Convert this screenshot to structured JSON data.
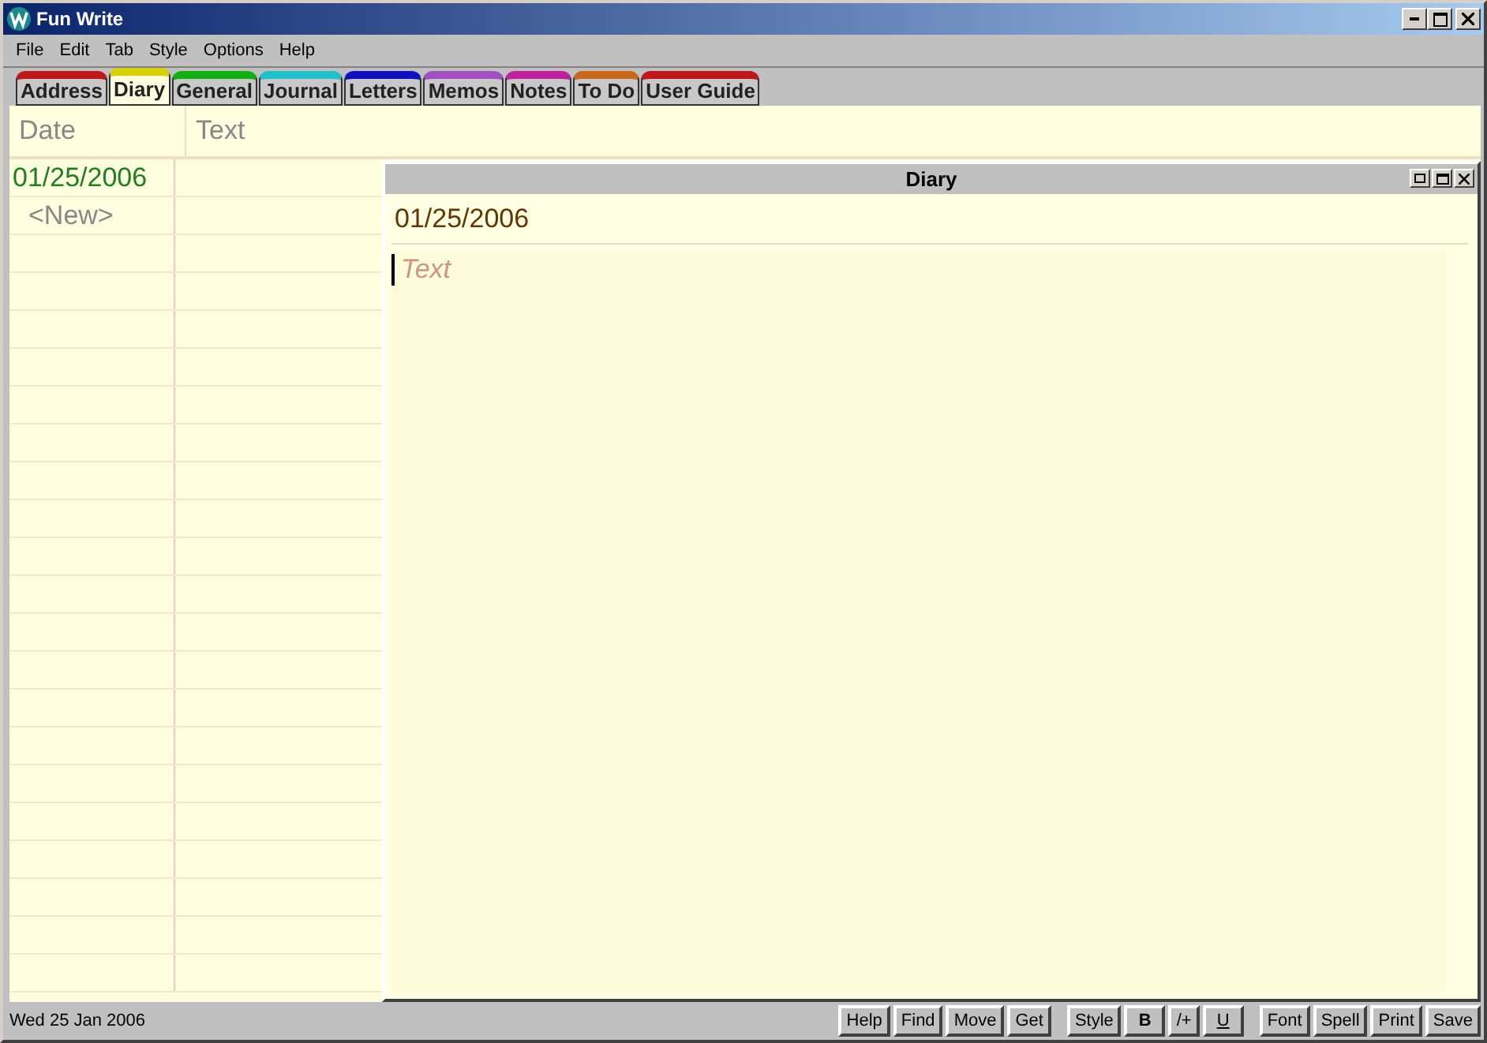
{
  "window": {
    "title": "Fun Write"
  },
  "menu": [
    "File",
    "Edit",
    "Tab",
    "Style",
    "Options",
    "Help"
  ],
  "tabs": [
    {
      "label": "Address",
      "color": "#c01818",
      "selected": false
    },
    {
      "label": "Diary",
      "color": "#d8d000",
      "selected": true
    },
    {
      "label": "General",
      "color": "#10b010",
      "selected": false
    },
    {
      "label": "Journal",
      "color": "#20c0c8",
      "selected": false
    },
    {
      "label": "Letters",
      "color": "#1010c0",
      "selected": false
    },
    {
      "label": "Memos",
      "color": "#a050c0",
      "selected": false
    },
    {
      "label": "Notes",
      "color": "#c020a0",
      "selected": false
    },
    {
      "label": "To Do",
      "color": "#c86818",
      "selected": false
    },
    {
      "label": "User Guide",
      "color": "#c01818",
      "selected": false
    }
  ],
  "list": {
    "columns": [
      "Date",
      "Text"
    ],
    "rows": [
      {
        "date": "01/25/2006",
        "kind": "entry"
      },
      {
        "date": "<New>",
        "kind": "new"
      }
    ]
  },
  "editor": {
    "title": "Diary",
    "date": "01/25/2006",
    "text_placeholder": "Text"
  },
  "status_bar": {
    "date": "Wed 25 Jan 2006"
  },
  "buttons": [
    {
      "label": "Help",
      "kind": "plain"
    },
    {
      "label": "Find",
      "kind": "plain"
    },
    {
      "label": "Move",
      "kind": "plain"
    },
    {
      "label": "Get",
      "kind": "plain"
    },
    {
      "label": "Style",
      "kind": "plain"
    },
    {
      "label": "B",
      "kind": "bold"
    },
    {
      "label": "/+",
      "kind": "plain"
    },
    {
      "label": "U",
      "kind": "underline"
    },
    {
      "label": "Font",
      "kind": "plain"
    },
    {
      "label": "Spell",
      "kind": "plain"
    },
    {
      "label": "Print",
      "kind": "plain"
    },
    {
      "label": "Save",
      "kind": "plain"
    }
  ]
}
